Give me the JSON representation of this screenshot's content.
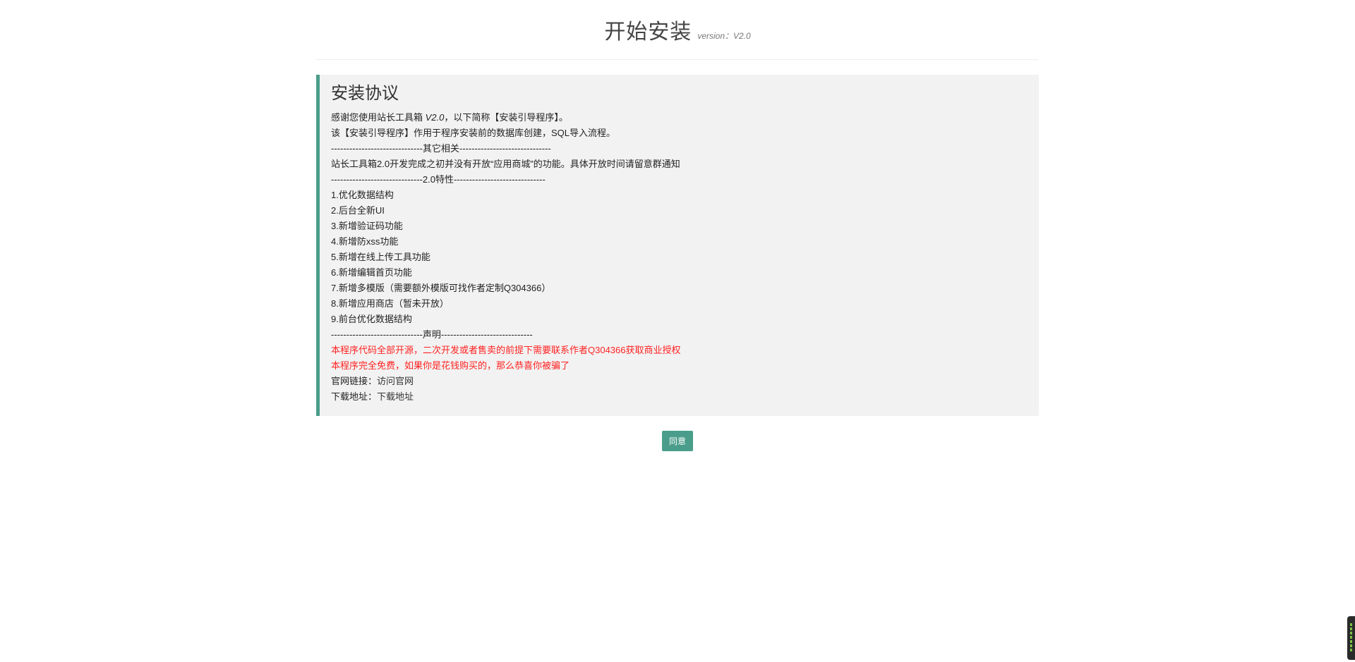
{
  "header": {
    "title": "开始安装",
    "version_label": "version：V2.0"
  },
  "agreement": {
    "heading": "安装协议",
    "intro_prefix": "感谢您使用站长工具箱 ",
    "intro_version": "V2.0",
    "intro_suffix": "，以下简称【安装引导程序】。",
    "lines_top": [
      "该【安装引导程序】作用于程序安装前的数据库创建，SQL导入流程。",
      "------------------------------其它相关------------------------------",
      "站长工具箱2.0开发完成之初并没有开放“应用商城”的功能。具体开放时间请留意群通知",
      "------------------------------2.0特性------------------------------",
      "1.优化数据结构",
      "2.后台全新UI",
      "3.新增验证码功能",
      "4.新增防xss功能",
      "5.新增在线上传工具功能",
      "6.新增编辑首页功能",
      "7.新增多模版（需要额外模版可找作者定制Q304366）",
      "8.新增应用商店（暂未开放）",
      "9.前台优化数据结构",
      "------------------------------声明------------------------------"
    ],
    "notices": [
      "本程序代码全部开源，二次开发或者售卖的前提下需要联系作者Q304366获取商业授权",
      "本程序完全免费，如果你是花钱购买的，那么恭喜你被骗了"
    ],
    "website_label": "官网链接：",
    "website_link": "访问官网",
    "download_label": "下载地址：",
    "download_link": "下载地址"
  },
  "actions": {
    "agree_label": "同意"
  },
  "colors": {
    "accent": "#4a9d8a",
    "notice": "#ff2222",
    "panel_bg": "#f2f2f2"
  }
}
